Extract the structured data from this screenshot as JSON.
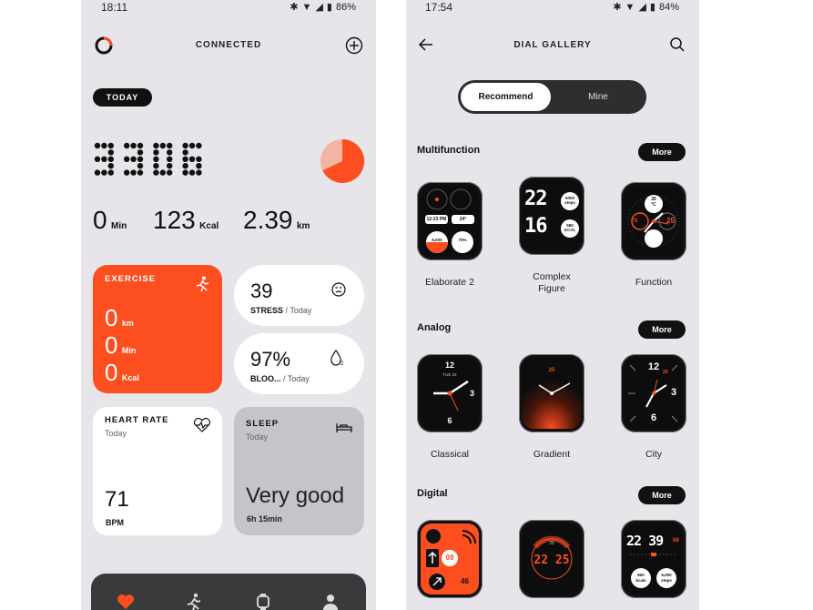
{
  "left_screen": {
    "status": {
      "time": "18:11",
      "battery": "86%"
    },
    "header": {
      "title": "CONNECTED"
    },
    "today_pill": "TODAY",
    "steps": "3306",
    "stats": [
      {
        "value": "0",
        "unit": "Min"
      },
      {
        "value": "123",
        "unit": "Kcal"
      },
      {
        "value": "2.39",
        "unit": "km"
      }
    ],
    "exercise_card": {
      "title": "EXERCISE",
      "rows": [
        {
          "value": "0",
          "unit": "km"
        },
        {
          "value": "0",
          "unit": "Min"
        },
        {
          "value": "0",
          "unit": "Kcal"
        }
      ]
    },
    "stress_card": {
      "value": "39",
      "label": "STRESS",
      "sub": " / Today"
    },
    "blood_card": {
      "value": "97%",
      "label": "BLOO...",
      "sub": " / Today"
    },
    "heart_card": {
      "title": "HEART RATE",
      "sub": "Today",
      "value": "71",
      "unit": "BPM"
    },
    "sleep_card": {
      "title": "SLEEP",
      "sub": "Today",
      "value": "Very good",
      "duration": "6h 15min"
    },
    "colors": {
      "accent": "#fc4e1e",
      "background": "#e7e5ea",
      "dark": "#111111"
    }
  },
  "right_screen": {
    "status": {
      "time": "17:54",
      "battery": "84%"
    },
    "header": {
      "title": "DIAL GALLERY"
    },
    "tabs": {
      "active": "Recommend",
      "inactive": "Mine"
    },
    "sections": [
      {
        "title": "Multifunction",
        "more": "More",
        "dials": [
          {
            "name": "Elaborate 2"
          },
          {
            "name": "Complex\nFigure"
          },
          {
            "name": "Function"
          }
        ]
      },
      {
        "title": "Analog",
        "more": "More",
        "dials": [
          {
            "name": "Classical"
          },
          {
            "name": "Gradient"
          },
          {
            "name": "City"
          }
        ]
      },
      {
        "title": "Digital",
        "more": "More",
        "dials": [
          {},
          {},
          {}
        ]
      }
    ],
    "dial_texts": {
      "elaborate_time": "12:23 PM",
      "elaborate_temp": "24°",
      "elaborate_steps": "5,000",
      "elaborate_battery": "75%",
      "complex_digits_top": "22",
      "complex_digits_bottom": "16",
      "complex_steps": "5000\nsteps",
      "complex_kcal": "580\nKCAL",
      "function_temp": "26\n°C",
      "function_75": "75",
      "function_25": "25",
      "classical_date": "TUE 24",
      "classical_12": "12",
      "classical_3": "3",
      "classical_6": "6",
      "gradient_25": "25",
      "city_12": "12",
      "city_3": "3",
      "city_6": "6",
      "city_25": "25",
      "digital1_09": "09",
      "digital1_46": "46",
      "digital2_time": "22 25",
      "digital2_small": "25",
      "digital3_time": "22 39",
      "digital3_59": "59",
      "digital3_kcal": "800\nkcals",
      "digital3_steps": "5,000\nsteps"
    }
  }
}
